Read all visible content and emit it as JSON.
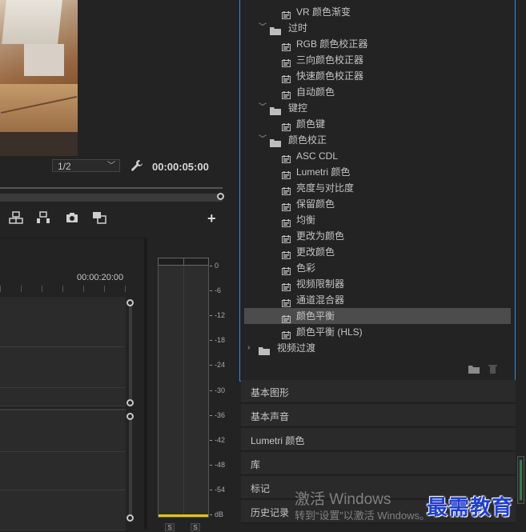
{
  "monitor": {
    "resolution": "1/2",
    "timecode": "00:00:05:00",
    "tools": [
      "insert-icon",
      "overwrite-icon",
      "camera-icon",
      "compare-icon"
    ],
    "add_label": "+"
  },
  "timeline": {
    "ruler_time": "00:00:20:00"
  },
  "audio_meter": {
    "scale": [
      "0",
      "-6",
      "-12",
      "-18",
      "-24",
      "-30",
      "-36",
      "-42",
      "-48",
      "-54",
      "dB"
    ],
    "solo": [
      "S",
      "S"
    ],
    "level_color": "#e8c21a"
  },
  "effects": {
    "rows": [
      {
        "type": "effect",
        "label": "VR 颜色渐变",
        "indent": 2
      },
      {
        "type": "folder",
        "label": "过时",
        "expanded": true
      },
      {
        "type": "effect",
        "label": "RGB 颜色校正器",
        "indent": 2
      },
      {
        "type": "effect",
        "label": "三向颜色校正器",
        "indent": 2
      },
      {
        "type": "effect",
        "label": "快速颜色校正器",
        "indent": 2
      },
      {
        "type": "effect",
        "label": "自动颜色",
        "indent": 2
      },
      {
        "type": "folder",
        "label": "键控",
        "expanded": true
      },
      {
        "type": "effect",
        "label": "颜色键",
        "indent": 2
      },
      {
        "type": "folder",
        "label": "颜色校正",
        "expanded": true
      },
      {
        "type": "effect",
        "label": "ASC CDL",
        "indent": 2
      },
      {
        "type": "effect",
        "label": "Lumetri 颜色",
        "indent": 2
      },
      {
        "type": "effect",
        "label": "亮度与对比度",
        "indent": 2
      },
      {
        "type": "effect",
        "label": "保留颜色",
        "indent": 2
      },
      {
        "type": "effect",
        "label": "均衡",
        "indent": 2
      },
      {
        "type": "effect",
        "label": "更改为颜色",
        "indent": 2
      },
      {
        "type": "effect",
        "label": "更改颜色",
        "indent": 2
      },
      {
        "type": "effect",
        "label": "色彩",
        "indent": 2
      },
      {
        "type": "effect",
        "label": "视频限制器",
        "indent": 2
      },
      {
        "type": "effect",
        "label": "通道混合器",
        "indent": 2
      },
      {
        "type": "effect",
        "label": "颜色平衡",
        "indent": 2,
        "selected": true
      },
      {
        "type": "effect",
        "label": "颜色平衡 (HLS)",
        "indent": 2
      },
      {
        "type": "folder",
        "label": "视频过渡",
        "expanded": false,
        "top": true
      }
    ],
    "footer_icons": [
      "new-bin-icon",
      "trash-icon"
    ],
    "accent": "#2f8edc"
  },
  "panels": [
    {
      "label": "基本图形"
    },
    {
      "label": "基本声音"
    },
    {
      "label": "Lumetri 颜色"
    },
    {
      "label": "库"
    },
    {
      "label": "标记"
    },
    {
      "label": "历史记录"
    }
  ],
  "watermark": {
    "activate": "激活 Windows",
    "sub": "转到“设置”以激活 Windows。",
    "brand": "最需教育",
    "brand_color": "#1f3fd1"
  }
}
